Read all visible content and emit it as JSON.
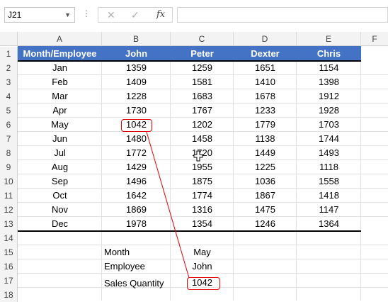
{
  "formula_bar": {
    "name_box": "J21",
    "cancel_icon": "✕",
    "enter_icon": "✓",
    "fx_label": "fx",
    "formula": ""
  },
  "columns": [
    "A",
    "B",
    "C",
    "D",
    "E",
    "F"
  ],
  "rows": [
    "1",
    "2",
    "3",
    "4",
    "5",
    "6",
    "7",
    "8",
    "9",
    "10",
    "11",
    "12",
    "13",
    "14",
    "15",
    "16",
    "17",
    "18"
  ],
  "table": {
    "headers": [
      "Month/Employee",
      "John",
      "Peter",
      "Dexter",
      "Chris"
    ],
    "rows": [
      [
        "Jan",
        "1359",
        "1259",
        "1651",
        "1154"
      ],
      [
        "Feb",
        "1409",
        "1581",
        "1410",
        "1398"
      ],
      [
        "Mar",
        "1228",
        "1683",
        "1678",
        "1912"
      ],
      [
        "Apr",
        "1730",
        "1767",
        "1233",
        "1928"
      ],
      [
        "May",
        "1042",
        "1202",
        "1779",
        "1703"
      ],
      [
        "Jun",
        "1480",
        "1458",
        "1138",
        "1744"
      ],
      [
        "Jul",
        "1772",
        "1720",
        "1449",
        "1493"
      ],
      [
        "Aug",
        "1429",
        "1955",
        "1225",
        "1118"
      ],
      [
        "Sep",
        "1496",
        "1875",
        "1036",
        "1558"
      ],
      [
        "Oct",
        "1642",
        "1774",
        "1867",
        "1418"
      ],
      [
        "Nov",
        "1869",
        "1316",
        "1475",
        "1147"
      ],
      [
        "Dec",
        "1978",
        "1354",
        "1246",
        "1364"
      ]
    ]
  },
  "lookup": {
    "month_label": "Month",
    "month_value": "May",
    "employee_label": "Employee",
    "employee_value": "John",
    "qty_label": "Sales Quantity",
    "qty_value": "1042"
  },
  "colors": {
    "header_fill": "#4472c4",
    "highlight": "#e00000"
  }
}
